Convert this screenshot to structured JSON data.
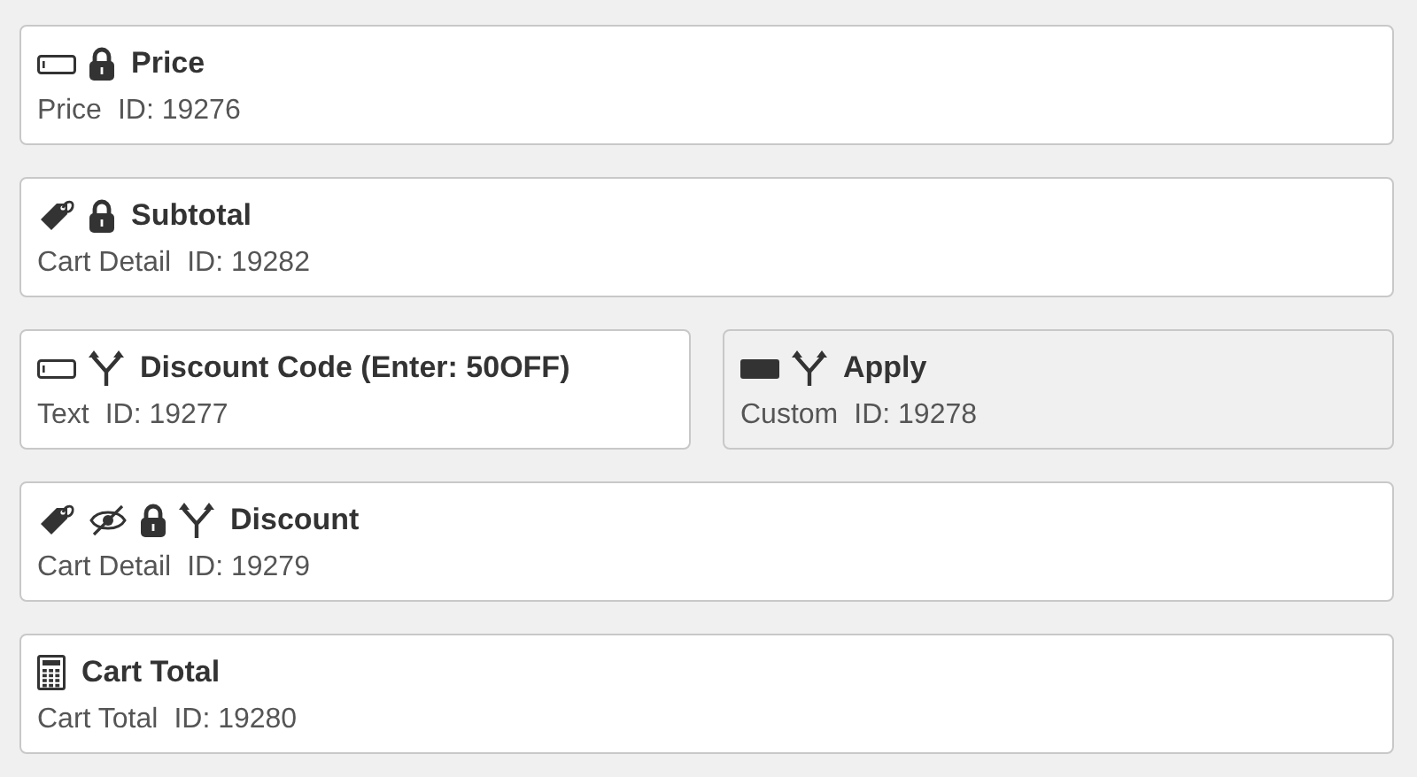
{
  "rows": [
    {
      "cards": [
        {
          "kind": "field",
          "hidden": false,
          "locked": true,
          "conditional": false,
          "selected": false,
          "title": "Price",
          "subtitle": "Price",
          "id": "ID: 19276"
        }
      ]
    },
    {
      "cards": [
        {
          "kind": "tag",
          "hidden": false,
          "locked": true,
          "conditional": false,
          "selected": false,
          "title": "Subtotal",
          "subtitle": "Cart Detail",
          "id": "ID: 19282"
        }
      ]
    },
    {
      "cards": [
        {
          "kind": "field",
          "hidden": false,
          "locked": false,
          "conditional": true,
          "selected": false,
          "title": "Discount Code (Enter: 50OFF)",
          "subtitle": "Text",
          "id": "ID: 19277"
        },
        {
          "kind": "button",
          "hidden": false,
          "locked": false,
          "conditional": true,
          "selected": true,
          "title": "Apply",
          "subtitle": "Custom",
          "id": "ID: 19278"
        }
      ]
    },
    {
      "cards": [
        {
          "kind": "tag",
          "hidden": true,
          "locked": true,
          "conditional": true,
          "selected": false,
          "title": "Discount",
          "subtitle": "Cart Detail",
          "id": "ID: 19279"
        }
      ]
    },
    {
      "cards": [
        {
          "kind": "calculator",
          "hidden": false,
          "locked": false,
          "conditional": false,
          "selected": false,
          "title": "Cart Total",
          "subtitle": "Cart Total",
          "id": "ID: 19280"
        }
      ]
    }
  ]
}
